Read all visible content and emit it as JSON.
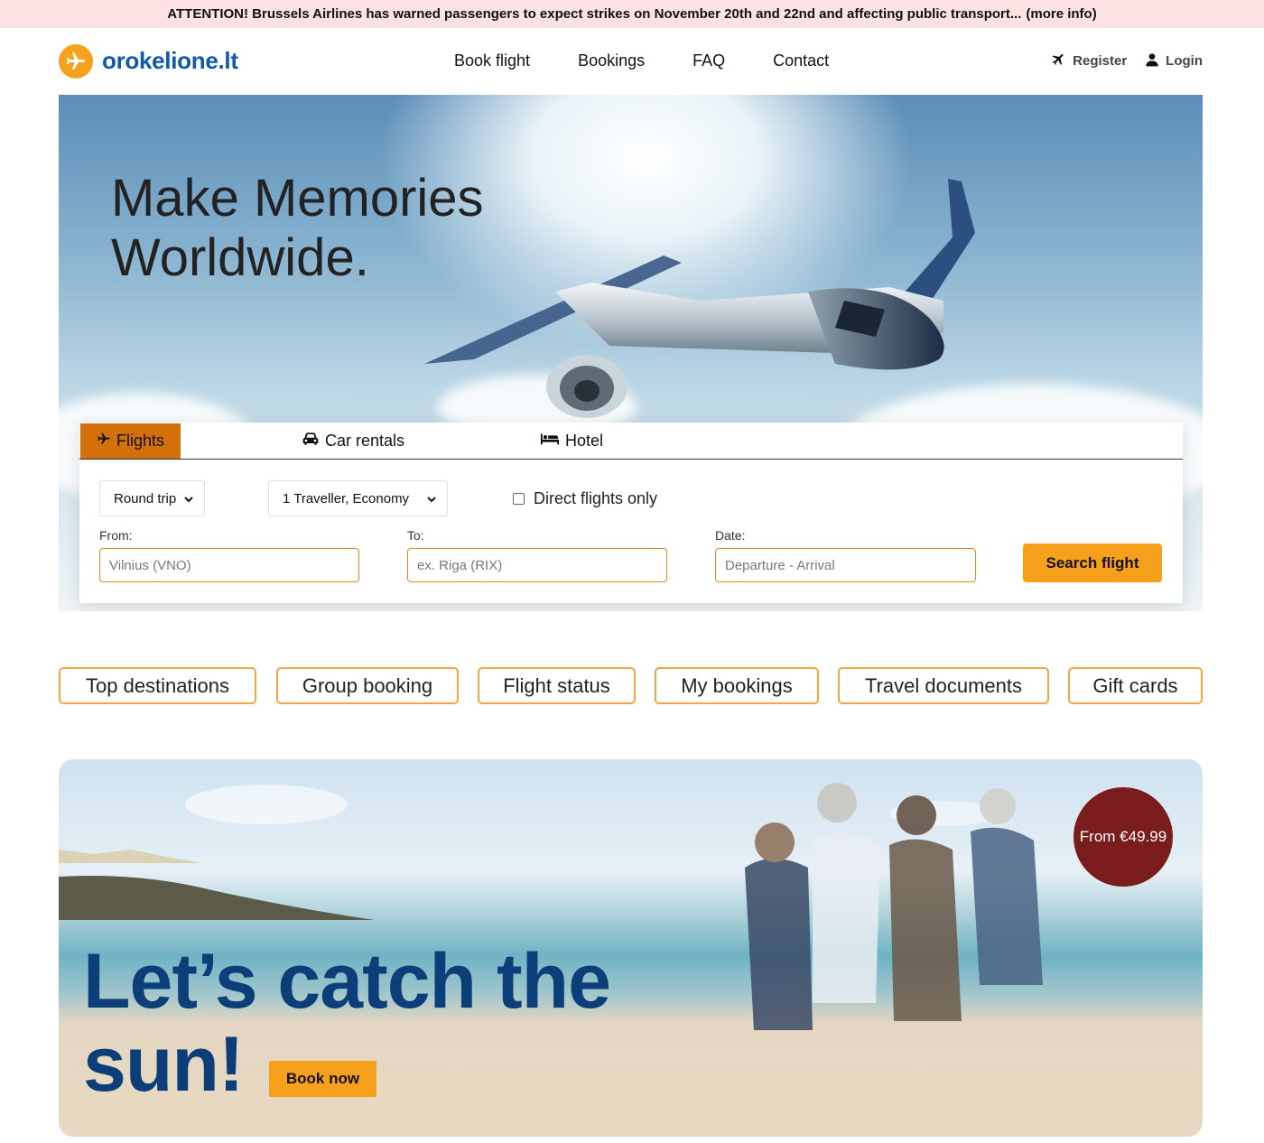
{
  "alert": {
    "text": "ATTENTION! Brussels Airlines has warned passengers to expect strikes on November 20th and 22nd and affecting public transport...",
    "more": "(more info)"
  },
  "header": {
    "logo_text": "orokelione.lt",
    "nav": [
      "Book flight",
      "Bookings",
      "FAQ",
      "Contact"
    ],
    "register": "Register",
    "login": "Login"
  },
  "hero": {
    "title_line1": "Make Memories",
    "title_line2": "Worldwide."
  },
  "search": {
    "tabs": {
      "flights": "Flights",
      "cars": "Car rentals",
      "hotel": "Hotel"
    },
    "trip_type": "Round trip",
    "travellers": "1 Traveller, Economy",
    "direct_only": "Direct flights only",
    "from_label": "From:",
    "from_placeholder": "Vilnius (VNO)",
    "to_label": "To:",
    "to_placeholder": "ex. Riga (RIX)",
    "date_label": "Date:",
    "date_placeholder": "Departure - Arrival",
    "button": "Search flight"
  },
  "quick_links": [
    "Top destinations",
    "Group booking",
    "Flight status",
    "My bookings",
    "Travel documents",
    "Gift cards"
  ],
  "promo": {
    "title_line1": "Let’s catch the",
    "title_line2": "sun!",
    "button": "Book now",
    "badge": "From €49.99"
  },
  "colors": {
    "accent": "#f7a01c",
    "brand_blue": "#0f5aa8",
    "alert_bg": "#fde2e4",
    "badge": "#7a1c1c"
  }
}
